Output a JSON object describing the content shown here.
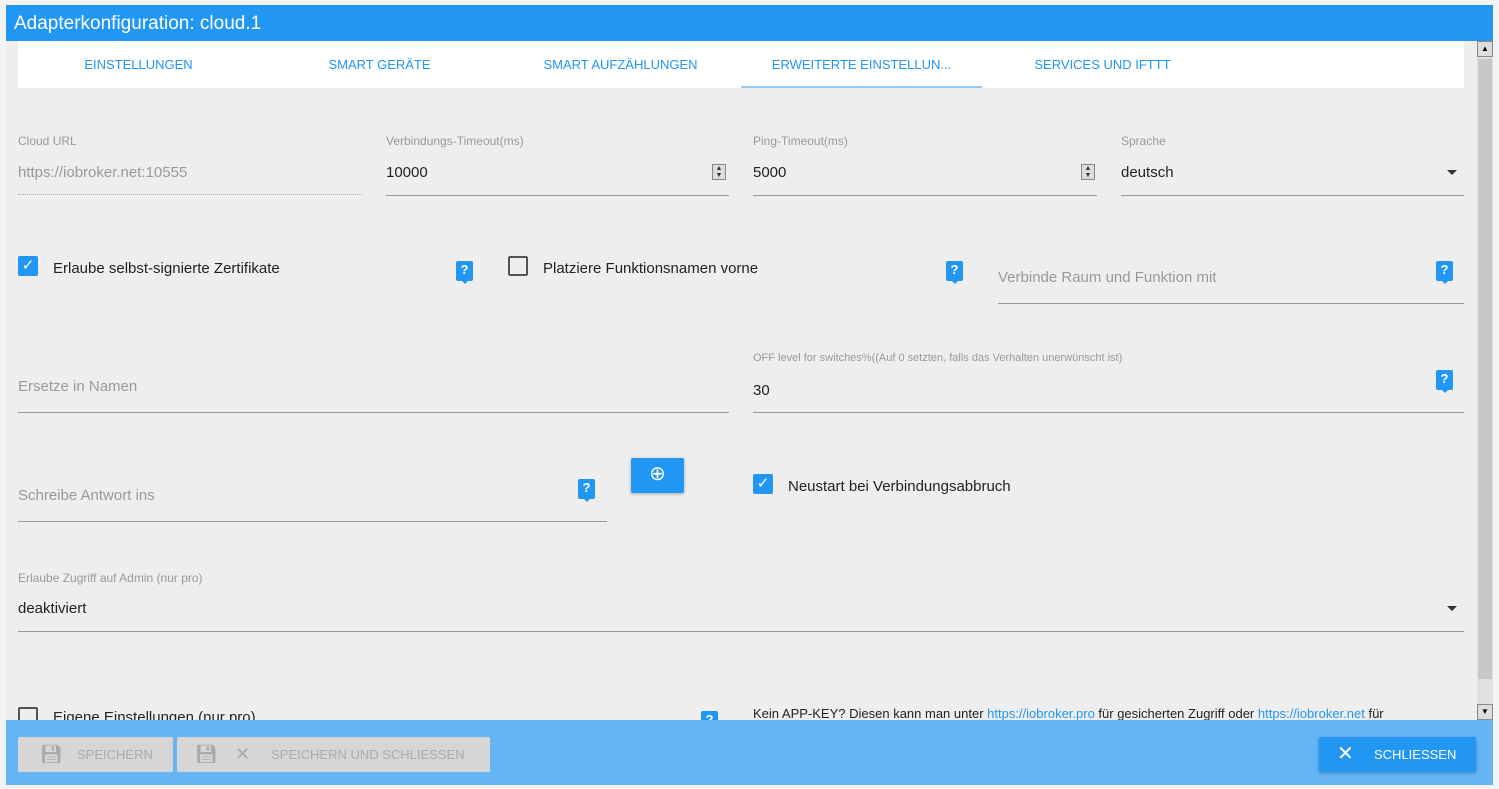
{
  "title": "Adapterkonfiguration: cloud.1",
  "tabs": [
    "EINSTELLUNGEN",
    "SMART GERÄTE",
    "SMART AUFZÄHLUNGEN",
    "ERWEITERTE EINSTELLUN...",
    "SERVICES UND IFTTT"
  ],
  "active_tab": 3,
  "fields": {
    "cloud_url": {
      "label": "Cloud URL",
      "value": "https://iobroker.net:10555"
    },
    "conn_timeout": {
      "label": "Verbindungs-Timeout(ms)",
      "value": "10000"
    },
    "ping_timeout": {
      "label": "Ping-Timeout(ms)",
      "value": "5000"
    },
    "language": {
      "label": "Sprache",
      "value": "deutsch"
    },
    "allow_selfsigned": {
      "label": "Erlaube selbst-signierte Zertifikate",
      "checked": true
    },
    "func_first": {
      "label": "Platziere Funktionsnamen vorne",
      "checked": false
    },
    "concat_word": {
      "placeholder": "Verbinde Raum und Funktion mit"
    },
    "replace_names": {
      "placeholder": "Ersetze in Namen"
    },
    "off_level": {
      "label": "OFF level for switches%((Auf 0 setzten, falls das Verhalten unerwünscht ist)",
      "value": "30"
    },
    "response_id": {
      "placeholder": "Schreibe Antwort ins"
    },
    "restart_on_disconnect": {
      "label": "Neustart bei Verbindungsabbruch",
      "checked": true
    },
    "allow_admin": {
      "label": "Erlaube Zugriff auf Admin (nur pro)",
      "value": "deaktiviert"
    },
    "own_settings": {
      "label": "Eigene Einstellungen (nur pro)",
      "checked": false
    }
  },
  "appkey_note": {
    "before": "Kein APP-KEY? Diesen kann man unter ",
    "link1": "https://iobroker.pro",
    "middle": " für gesicherten Zugriff oder ",
    "link2": "https://iobroker.net",
    "after": " für"
  },
  "footer": {
    "save": "SPEICHERN",
    "save_close": "SPEICHERN UND SCHLIESSEN",
    "close": "SCHLIESSEN"
  },
  "colors": {
    "primary": "#2196f3",
    "footer": "#64b5f6",
    "background": "#eeeeee"
  }
}
